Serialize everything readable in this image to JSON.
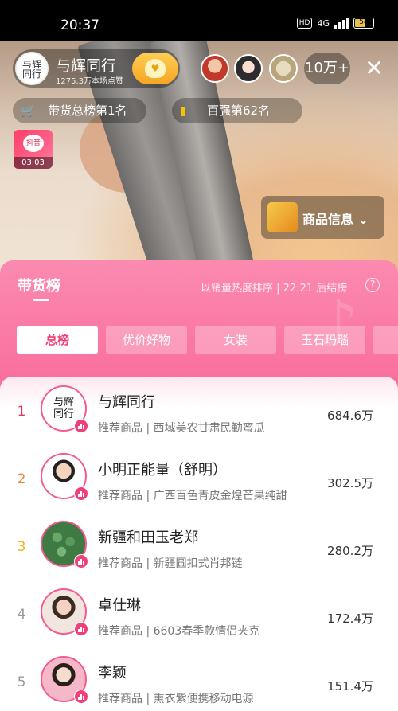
{
  "status_bar": {
    "time": "20:37",
    "hd": "HD",
    "network": "4G",
    "battery": "58"
  },
  "host": {
    "avatar_text": "与辉\n同行",
    "name": "与辉同行",
    "likes": "1275.3万本场点赞"
  },
  "viewers": {
    "count": "10万+"
  },
  "rank_pills": [
    {
      "label": "带货总榜第1名",
      "icon": "cart-icon"
    },
    {
      "label": "百强第62名",
      "icon": "bar-chart-icon"
    }
  ],
  "gift": {
    "label": "抖音",
    "timer": "03:03"
  },
  "goods_button": {
    "label": "商品信息",
    "chevron": "⌄"
  },
  "panel": {
    "title": "带货榜",
    "note": "以销量热度排序 | 22:21 后结榜",
    "help": "?",
    "tabs": [
      "总榜",
      "优价好物",
      "女装",
      "玉石玛瑙",
      ""
    ],
    "active_tab": 0
  },
  "ranking": [
    {
      "rank": "1",
      "name": "与辉同行",
      "desc": "推荐商品 | 西域美农甘肃民勤蜜瓜",
      "value": "684.6万",
      "rank_color": "#e8365d"
    },
    {
      "rank": "2",
      "name": "小明正能量（舒明）",
      "desc": "推荐商品 | 广西百色青皮金煌芒果纯甜",
      "value": "302.5万",
      "rank_color": "#f0803c"
    },
    {
      "rank": "3",
      "name": "新疆和田玉老郑",
      "desc": "推荐商品 | 新疆圆扣式肖邦链",
      "value": "280.2万",
      "rank_color": "#f2b01f"
    },
    {
      "rank": "4",
      "name": "卓仕琳",
      "desc": "推荐商品 | 6603春季款情侣夹克",
      "value": "172.4万",
      "rank_color": "#9a9a9a"
    },
    {
      "rank": "5",
      "name": "李颖",
      "desc": "推荐商品 | 熏衣紫便携移动电源",
      "value": "151.4万",
      "rank_color": "#9a9a9a"
    }
  ]
}
